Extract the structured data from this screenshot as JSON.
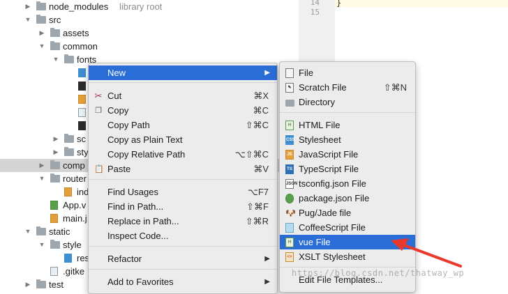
{
  "tree": {
    "rows": [
      {
        "label": "node_modules",
        "hint": "library root",
        "kind": "folder",
        "arrow": "▶"
      },
      {
        "label": "src",
        "kind": "folder",
        "arrow": "▼"
      },
      {
        "label": "assets",
        "kind": "folder",
        "arrow": "▶"
      },
      {
        "label": "common",
        "kind": "folder",
        "arrow": "▼"
      },
      {
        "label": "fonts",
        "kind": "folder",
        "arrow": "▼"
      },
      {
        "label": "",
        "kind": "css"
      },
      {
        "label": "",
        "kind": "term"
      },
      {
        "label": "",
        "kind": "js"
      },
      {
        "label": "",
        "kind": "doc"
      },
      {
        "label": "",
        "kind": "term"
      },
      {
        "label": "sc",
        "kind": "folder",
        "arrow": "▶"
      },
      {
        "label": "sty",
        "kind": "folder",
        "arrow": "▶"
      },
      {
        "label": "comp",
        "kind": "folder",
        "arrow": "▶"
      },
      {
        "label": "router",
        "kind": "folder",
        "arrow": "▼"
      },
      {
        "label": "ind",
        "kind": "js"
      },
      {
        "label": "App.v",
        "kind": "vue"
      },
      {
        "label": "main.j",
        "kind": "js"
      },
      {
        "label": "static",
        "kind": "folder",
        "arrow": "▼"
      },
      {
        "label": "style",
        "kind": "folder",
        "arrow": "▼"
      },
      {
        "label": "rese",
        "kind": "css"
      },
      {
        "label": ".gitke",
        "kind": "doc"
      },
      {
        "label": "test",
        "kind": "folder",
        "arrow": "▶"
      }
    ]
  },
  "editor": {
    "lines": [
      "14",
      "15"
    ],
    "code": "}"
  },
  "context_menu": {
    "new": "New",
    "cut": "Cut",
    "cut_sc": "⌘X",
    "copy": "Copy",
    "copy_sc": "⌘C",
    "copy_path": "Copy Path",
    "copy_path_sc": "⇧⌘C",
    "copy_plain": "Copy as Plain Text",
    "copy_relative": "Copy Relative Path",
    "copy_relative_sc": "⌥⇧⌘C",
    "paste": "Paste",
    "paste_sc": "⌘V",
    "find_usages": "Find Usages",
    "find_usages_sc": "⌥F7",
    "find_in_path": "Find in Path...",
    "find_in_path_sc": "⇧⌘F",
    "replace_in_path": "Replace in Path...",
    "replace_in_path_sc": "⇧⌘R",
    "inspect_code": "Inspect Code...",
    "refactor": "Refactor",
    "add_favorites": "Add to Favorites"
  },
  "new_submenu": {
    "file": "File",
    "scratch": "Scratch File",
    "scratch_sc": "⇧⌘N",
    "directory": "Directory",
    "html": "HTML File",
    "stylesheet": "Stylesheet",
    "javascript": "JavaScript File",
    "typescript": "TypeScript File",
    "tsconfig": "tsconfig.json File",
    "package": "package.json File",
    "pug": "Pug/Jade file",
    "coffee": "CoffeeScript File",
    "vue": "vue File",
    "xslt": "XSLT Stylesheet",
    "edit_templates": "Edit File Templates..."
  },
  "watermark": "https://blog.csdn.net/thatway_wp",
  "colors": {
    "highlight": "#2b6dd7",
    "annotation": "#e8392c"
  }
}
